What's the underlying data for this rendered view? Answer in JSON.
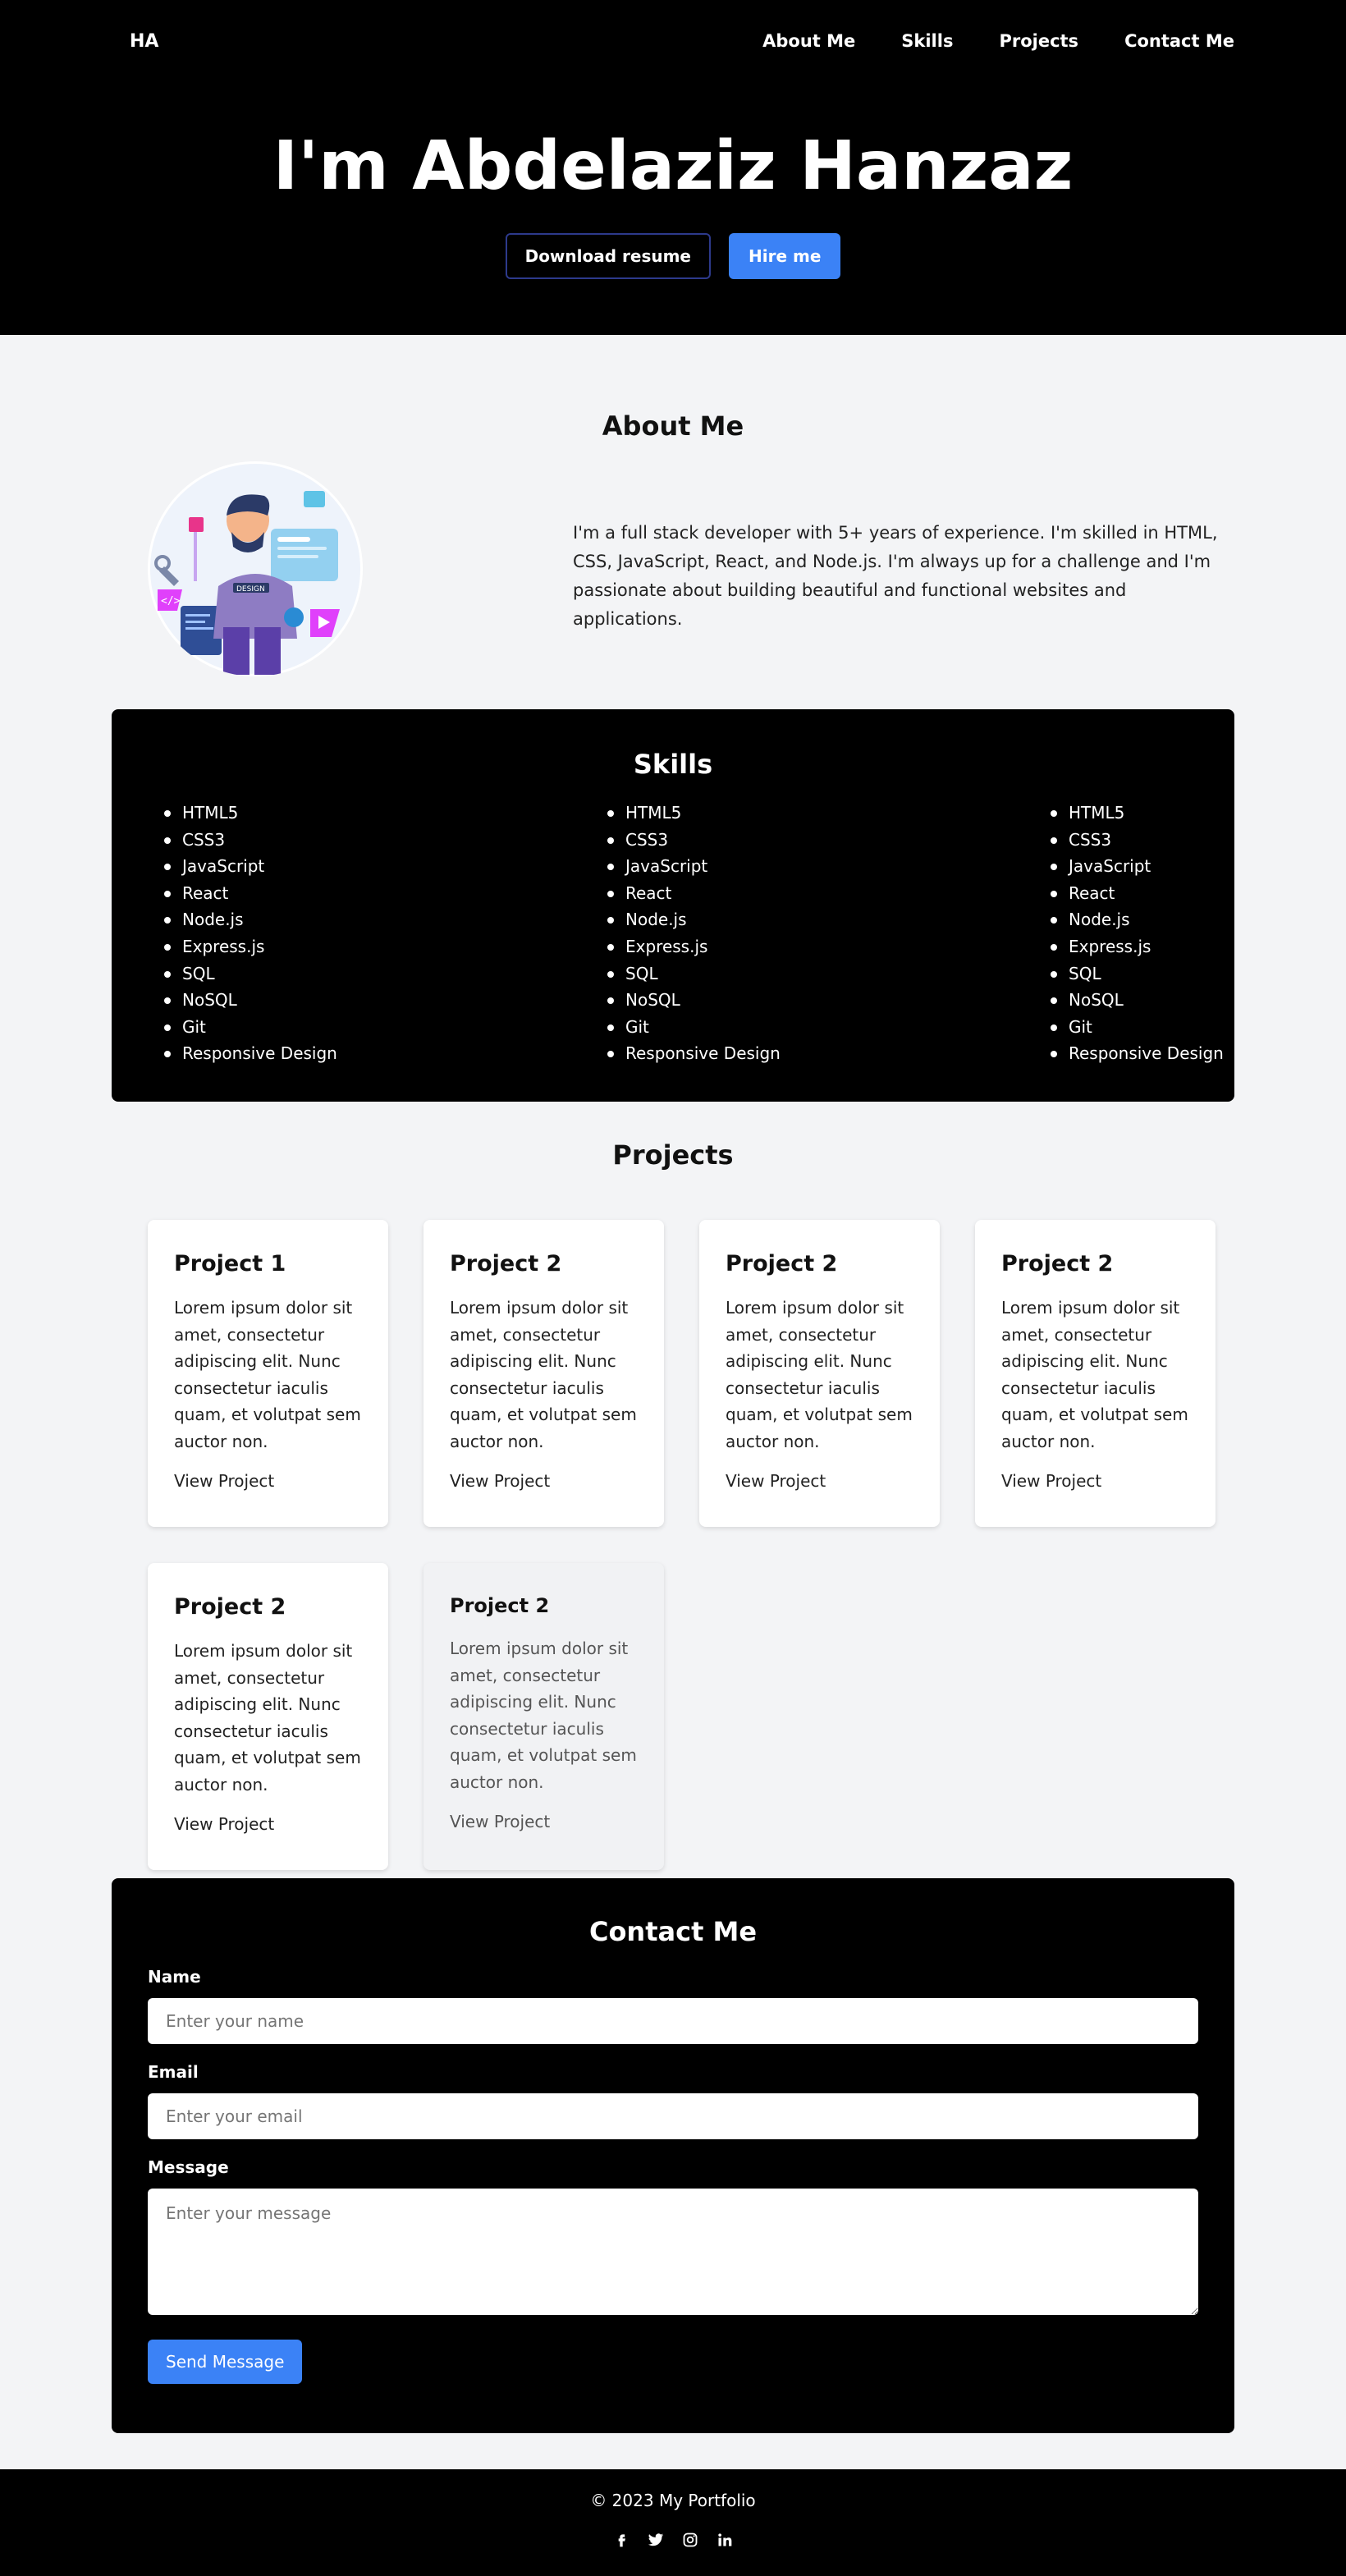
{
  "header": {
    "logo": "HA",
    "nav": [
      "About Me",
      "Skills",
      "Projects",
      "Contact Me"
    ]
  },
  "hero": {
    "title": "I'm Abdelaziz Hanzaz",
    "download_label": "Download resume",
    "hire_label": "Hire me"
  },
  "about": {
    "title": "About Me",
    "text": "I'm a full stack developer with 5+ years of experience. I'm skilled in HTML, CSS, JavaScript, React, and Node.js. I'm always up for a challenge and I'm passionate about building beautiful and functional websites and applications.",
    "image_label": "DESIGN"
  },
  "skills": {
    "title": "Skills",
    "columns": [
      [
        "HTML5",
        "CSS3",
        "JavaScript",
        "React",
        "Node.js",
        "Express.js",
        "SQL",
        "NoSQL",
        "Git",
        "Responsive Design"
      ],
      [
        "HTML5",
        "CSS3",
        "JavaScript",
        "React",
        "Node.js",
        "Express.js",
        "SQL",
        "NoSQL",
        "Git",
        "Responsive Design"
      ],
      [
        "HTML5",
        "CSS3",
        "JavaScript",
        "React",
        "Node.js",
        "Express.js",
        "SQL",
        "NoSQL",
        "Git",
        "Responsive Design"
      ]
    ]
  },
  "projects": {
    "title": "Projects",
    "cards": [
      {
        "title": "Project 1",
        "desc": "Lorem ipsum dolor sit amet, consectetur adipiscing elit. Nunc consectetur iaculis quam, et volutpat sem auctor non.",
        "link": "View Project"
      },
      {
        "title": "Project 2",
        "desc": "Lorem ipsum dolor sit amet, consectetur adipiscing elit. Nunc consectetur iaculis quam, et volutpat sem auctor non.",
        "link": "View Project"
      },
      {
        "title": "Project 2",
        "desc": "Lorem ipsum dolor sit amet, consectetur adipiscing elit. Nunc consectetur iaculis quam, et volutpat sem auctor non.",
        "link": "View Project"
      },
      {
        "title": "Project 2",
        "desc": "Lorem ipsum dolor sit amet, consectetur adipiscing elit. Nunc consectetur iaculis quam, et volutpat sem auctor non.",
        "link": "View Project"
      },
      {
        "title": "Project 2",
        "desc": "Lorem ipsum dolor sit amet, consectetur adipiscing elit. Nunc consectetur iaculis quam, et volutpat sem auctor non.",
        "link": "View Project"
      },
      {
        "title": "Project 2",
        "desc": "Lorem ipsum dolor sit amet, consectetur adipiscing elit. Nunc consectetur iaculis quam, et volutpat sem auctor non.",
        "link": "View Project"
      }
    ]
  },
  "contact": {
    "title": "Contact Me",
    "name_label": "Name",
    "name_placeholder": "Enter your name",
    "email_label": "Email",
    "email_placeholder": "Enter your email",
    "message_label": "Message",
    "message_placeholder": "Enter your message",
    "send_label": "Send Message"
  },
  "footer": {
    "copyright": "© 2023 My Portfolio",
    "socials": [
      "facebook-icon",
      "twitter-icon",
      "instagram-icon",
      "linkedin-icon"
    ]
  },
  "colors": {
    "accent": "#3b82f6",
    "dark": "#000000",
    "page_bg": "#f3f4f6"
  }
}
